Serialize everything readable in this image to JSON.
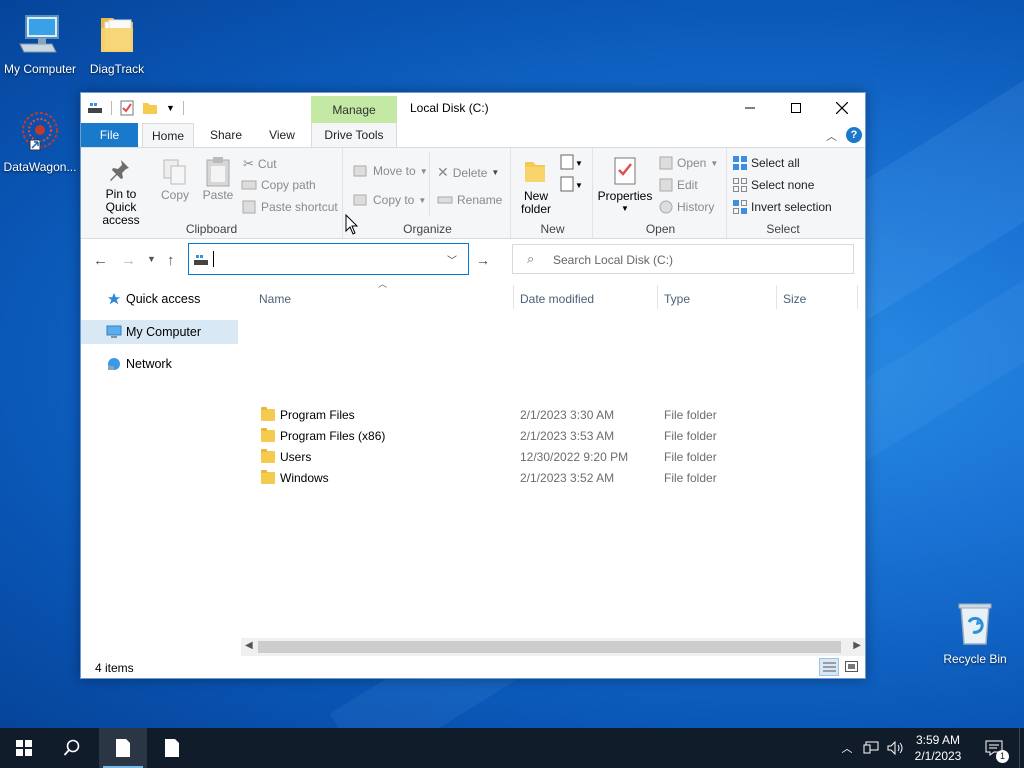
{
  "desktop": {
    "icons": [
      {
        "label": "My Computer"
      },
      {
        "label": "DiagTrack"
      },
      {
        "label": "DataWagon..."
      },
      {
        "label": "Recycle Bin"
      }
    ]
  },
  "window": {
    "title": "Local Disk (C:)",
    "context_tab": "Manage",
    "tabs": [
      "File",
      "Home",
      "Share",
      "View",
      "Drive Tools"
    ],
    "ribbon": {
      "clipboard": {
        "group_label": "Clipboard",
        "pin_label": "Pin to Quick access",
        "copy_label": "Copy",
        "paste_label": "Paste",
        "cut_label": "Cut",
        "copy_path_label": "Copy path",
        "paste_shortcut_label": "Paste shortcut"
      },
      "organize": {
        "group_label": "Organize",
        "move_to_label": "Move to",
        "copy_to_label": "Copy to",
        "delete_label": "Delete",
        "rename_label": "Rename"
      },
      "new": {
        "group_label": "New",
        "new_folder_label": "New folder"
      },
      "open": {
        "group_label": "Open",
        "properties_label": "Properties",
        "open_label": "Open",
        "edit_label": "Edit",
        "history_label": "History"
      },
      "select": {
        "group_label": "Select",
        "select_all_label": "Select all",
        "select_none_label": "Select none",
        "invert_label": "Invert selection"
      }
    },
    "address": {
      "value": ""
    },
    "search": {
      "placeholder": "Search Local Disk (C:)"
    },
    "nav_pane": [
      {
        "label": "Quick access",
        "selected": false
      },
      {
        "label": "My Computer",
        "selected": true
      },
      {
        "label": "Network",
        "selected": false
      }
    ],
    "columns": [
      "Name",
      "Date modified",
      "Type",
      "Size"
    ],
    "files": [
      {
        "name": "Program Files",
        "modified": "2/1/2023 3:30 AM",
        "type": "File folder",
        "size": ""
      },
      {
        "name": "Program Files (x86)",
        "modified": "2/1/2023 3:53 AM",
        "type": "File folder",
        "size": ""
      },
      {
        "name": "Users",
        "modified": "12/30/2022 9:20 PM",
        "type": "File folder",
        "size": ""
      },
      {
        "name": "Windows",
        "modified": "2/1/2023 3:52 AM",
        "type": "File folder",
        "size": ""
      }
    ],
    "status": {
      "item_count": "4 items"
    }
  },
  "taskbar": {
    "clock_time": "3:59 AM",
    "clock_date": "2/1/2023",
    "notification_count": "1"
  },
  "colors": {
    "accent": "#0078d7",
    "file_tab": "#1979ca",
    "manage_tab": "#c3e9a5",
    "taskbar": "#101c2a",
    "folder": "#f5cb4f",
    "selection": "#d9e8f5"
  }
}
